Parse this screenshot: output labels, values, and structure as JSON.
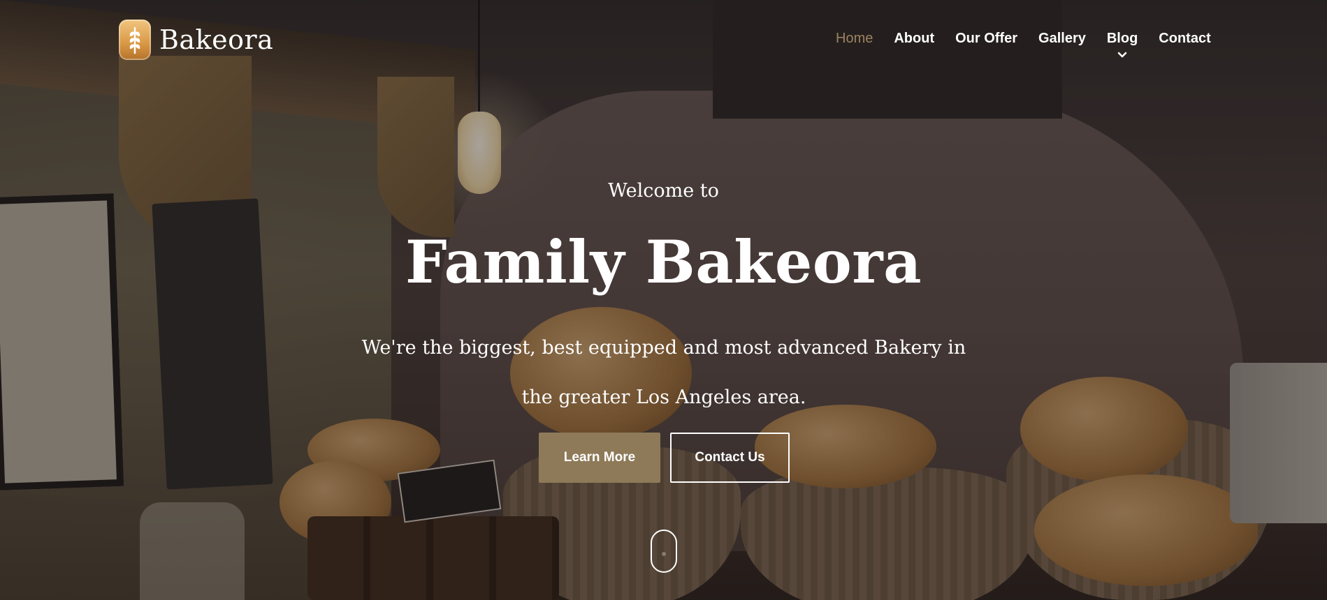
{
  "brand": {
    "name": "Bakeora",
    "logo_icon": "wheat-icon"
  },
  "nav": {
    "items": [
      {
        "label": "Home",
        "active": true
      },
      {
        "label": "About",
        "active": false
      },
      {
        "label": "Our Offer",
        "active": false
      },
      {
        "label": "Gallery",
        "active": false
      },
      {
        "label": "Blog",
        "active": false,
        "has_dropdown": true
      },
      {
        "label": "Contact",
        "active": false
      }
    ]
  },
  "hero": {
    "welcome": "Welcome to",
    "title": "Family Bakeora",
    "description": "We're the biggest, best equipped and most advanced Bakery in the greater Los Angeles area.",
    "primary_button": "Learn More",
    "secondary_button": "Contact Us",
    "scroll_icon": "mouse-scroll-icon"
  },
  "colors": {
    "accent": "#8e7a58",
    "nav_active": "#9c8260",
    "text": "#ffffff"
  }
}
